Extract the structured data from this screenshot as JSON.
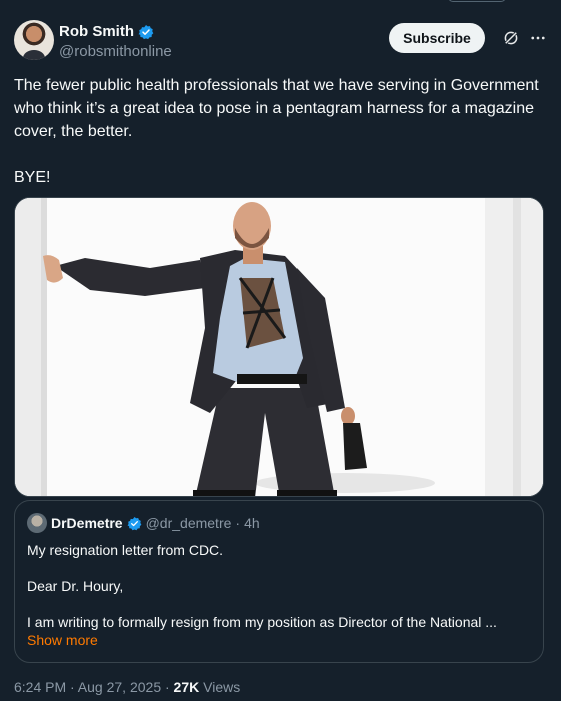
{
  "author": {
    "display_name": "Rob Smith",
    "handle": "@robsmithonline"
  },
  "actions": {
    "subscribe_label": "Subscribe"
  },
  "tweet": {
    "text": "The fewer public health professionals that we have serving in Government who think it’s a great idea to pose in a pentagram harness for a magazine cover, the better.\n\nBYE!"
  },
  "quote": {
    "display_name": "DrDemetre",
    "handle": "@dr_demetre",
    "separator": "·",
    "time": "4h",
    "line1": "My resignation letter from CDC.",
    "line2": "Dear Dr. Houry,",
    "line3": "I am writing to formally resign from my position as Director of the National ...",
    "show_more": "Show more"
  },
  "meta": {
    "timestamp": "6:24 PM · Aug 27, 2025 · ",
    "views_count": "27K",
    "views_label": "Views"
  },
  "colors": {
    "background": "#15202b",
    "verified": "#1d9bf0",
    "show_more": "#ff7a00",
    "muted": "#8b98a5"
  },
  "icons": [
    "verified-badge-icon",
    "grok-icon",
    "more-icon"
  ]
}
